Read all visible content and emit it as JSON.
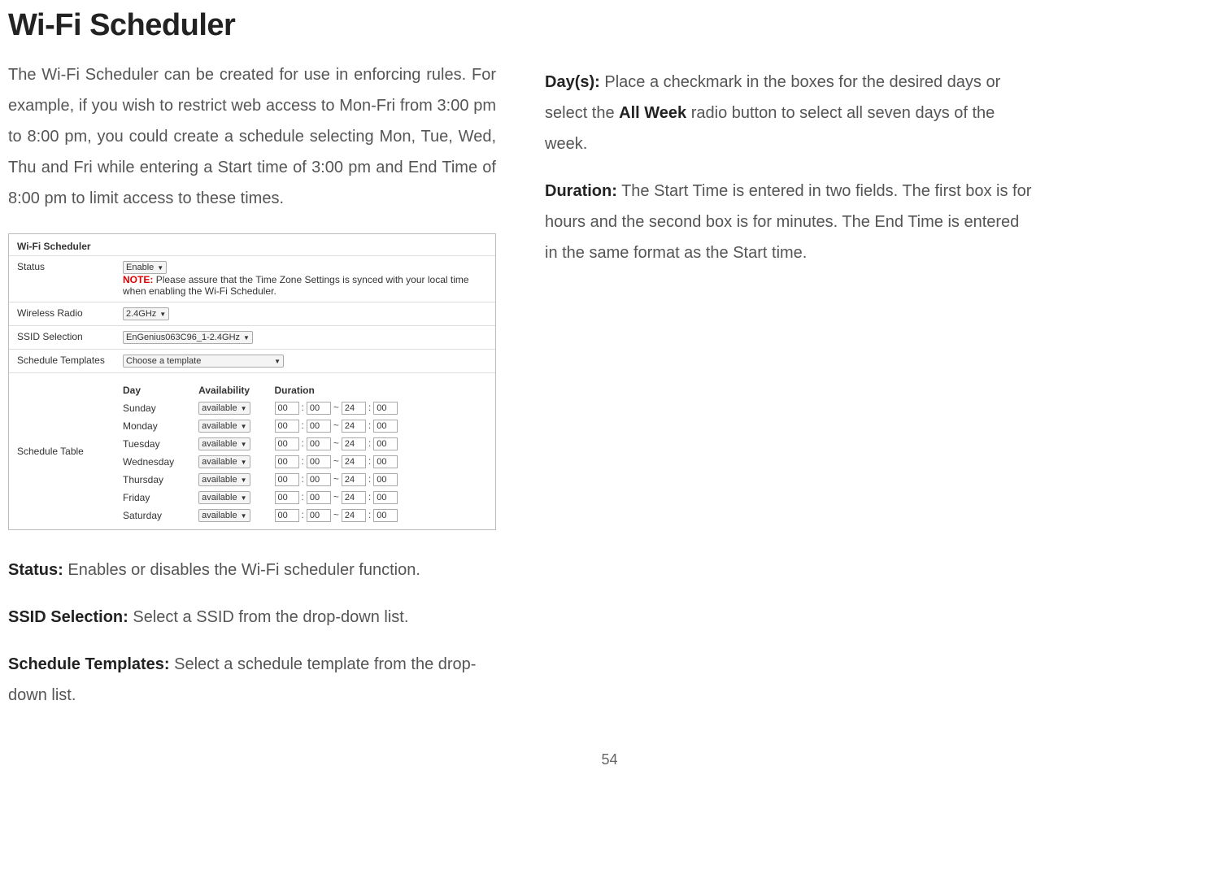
{
  "heading": "Wi-Fi Scheduler",
  "intro": "The Wi-Fi Scheduler can be created for use in enforcing rules. For example, if you wish to restrict web access to Mon-Fri from 3:00 pm to 8:00 pm, you could create a schedule selecting Mon, Tue, Wed, Thu and Fri while entering a Start time of 3:00 pm and End Time of 8:00 pm to limit access to these times.",
  "definitions": {
    "status": {
      "label": "Status:",
      "text": " Enables or disables the Wi-Fi scheduler function."
    },
    "ssidsel": {
      "label": "SSID Selection:",
      "text": " Select a SSID from the drop-down list."
    },
    "templates": {
      "label": "Schedule Templates:",
      "text": " Select a schedule template from the drop-down list."
    },
    "days": {
      "label": "Day(s):",
      "text_a": " Place a checkmark in the boxes for the desired days or select the ",
      "bold": "All Week",
      "text_b": " radio button to select all seven days of the week."
    },
    "duration": {
      "label": "Duration:",
      "text": " The Start Time is entered in two fields. The first box is for hours and the second box is for minutes. The End Time is entered in the same format as the Start time."
    }
  },
  "screenshot": {
    "title": "Wi-Fi Scheduler",
    "rows": {
      "status": {
        "label": "Status",
        "value": "Enable",
        "note_label": "NOTE:",
        "note_text": "  Please assure that the Time Zone Settings is synced with your local time when enabling the Wi-Fi Scheduler."
      },
      "radio": {
        "label": "Wireless Radio",
        "value": "2.4GHz"
      },
      "ssid": {
        "label": "SSID Selection",
        "value": "EnGenius063C96_1-2.4GHz"
      },
      "template": {
        "label": "Schedule Templates",
        "value": "Choose a template"
      },
      "table": {
        "label": "Schedule Table"
      }
    },
    "headers": {
      "day": "Day",
      "avail": "Availability",
      "dur": "Duration"
    },
    "availability_value": "available",
    "duration_default": {
      "sh": "00",
      "sm": "00",
      "eh": "24",
      "em": "00"
    },
    "days": [
      "Sunday",
      "Monday",
      "Tuesday",
      "Wednesday",
      "Thursday",
      "Friday",
      "Saturday"
    ]
  },
  "page_number": "54"
}
